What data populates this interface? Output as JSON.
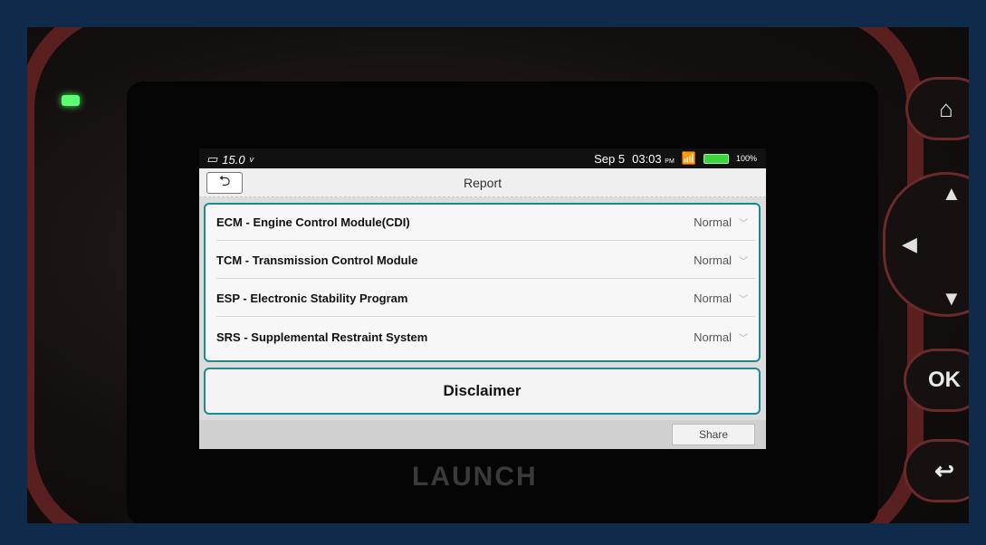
{
  "status_bar": {
    "voltage": "15.0",
    "voltage_unit": "v",
    "date": "Sep 5",
    "time": "03:03",
    "ampm": "PM",
    "battery_percent": "100%"
  },
  "header": {
    "title": "Report",
    "back_icon": "back-arrow-icon"
  },
  "systems": [
    {
      "label": "ECM - Engine Control Module(CDI)",
      "status": "Normal"
    },
    {
      "label": "TCM - Transmission Control Module",
      "status": "Normal"
    },
    {
      "label": "ESP - Electronic Stability Program",
      "status": "Normal"
    },
    {
      "label": "SRS - Supplemental Restraint System",
      "status": "Normal"
    }
  ],
  "disclaimer": {
    "label": "Disclaimer"
  },
  "footer": {
    "share_label": "Share"
  },
  "device": {
    "brand": "LAUNCH",
    "ok_label": "OK",
    "home_icon": "home-icon",
    "back_hw_icon": "return-icon"
  },
  "colors": {
    "accent": "#1b8a95",
    "battery": "#3fd43f",
    "led": "#5dff73"
  }
}
